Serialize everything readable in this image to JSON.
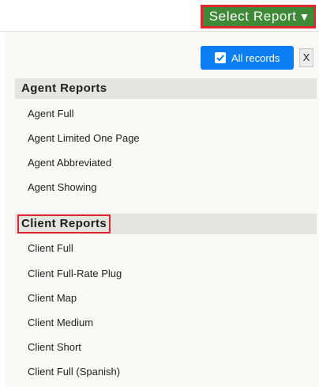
{
  "header": {
    "select_report_label": "Select Report",
    "select_report_caret": "▼"
  },
  "toolbar": {
    "all_records_label": "All records",
    "all_records_checked": true,
    "close_label": "X"
  },
  "agent_reports": {
    "title": "Agent Reports",
    "items": [
      {
        "label": "Agent Full"
      },
      {
        "label": "Agent Limited One Page"
      },
      {
        "label": "Agent Abbreviated"
      },
      {
        "label": "Agent Showing"
      }
    ]
  },
  "client_reports": {
    "title": "Client Reports",
    "items": [
      {
        "label": "Client Full"
      },
      {
        "label": "Client Full-Rate Plug"
      },
      {
        "label": "Client Map"
      },
      {
        "label": "Client Medium"
      },
      {
        "label": "Client Short"
      },
      {
        "label": "Client Full (Spanish)"
      }
    ]
  },
  "colors": {
    "select_report_bg": "#3e8a36",
    "highlight_border": "#e0262f",
    "all_records_bg": "#0a7ef2",
    "section_header_bg": "#e6e4df",
    "panel_bg": "#fbf9f6"
  }
}
